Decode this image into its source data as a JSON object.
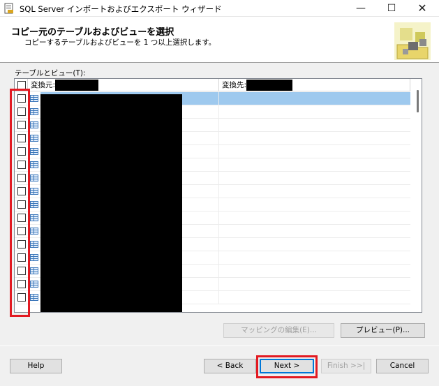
{
  "window": {
    "title": "SQL Server インポートおよびエクスポート ウィザード",
    "minimize_glyph": "—",
    "maximize_glyph": "☐",
    "close_glyph": "✕"
  },
  "header": {
    "title": "コピー元のテーブルおよびビューを選択",
    "subtitle": "コピーするテーブルおよびビューを 1 つ以上選択します。"
  },
  "grid": {
    "label": "テーブルとビュー(T):",
    "columns": {
      "source": "変換元:",
      "destination": "変換先:"
    },
    "row_count": 16,
    "selected_row": 0,
    "row_icon": "table-icon"
  },
  "buttons": {
    "edit_mappings": "マッピングの編集(E)...",
    "preview": "プレビュー(P)...",
    "help": "Help",
    "back": "< Back",
    "next": "Next >",
    "finish": "Finish >>|",
    "cancel": "Cancel"
  },
  "colors": {
    "highlight_box": "#e21a22",
    "selected_row": "#9ec9ee",
    "default_button_border": "#0078d7"
  }
}
